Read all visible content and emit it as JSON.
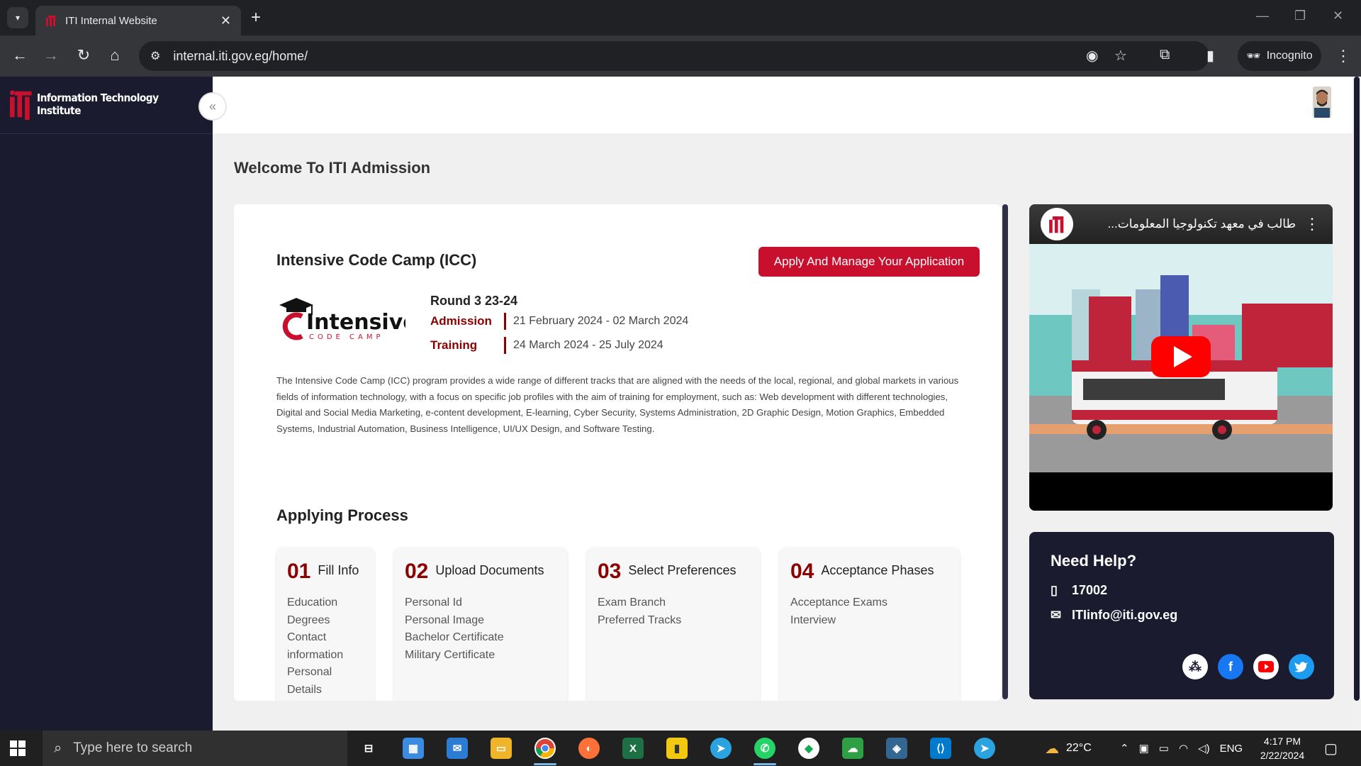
{
  "browser": {
    "tab_title": "ITI Internal Website",
    "url": "internal.iti.gov.eg/home/",
    "incognito_label": "Incognito"
  },
  "sidebar": {
    "brand_name": "Information Technology Institute"
  },
  "main": {
    "welcome": "Welcome To ITI Admission",
    "program_title": "Intensive Code Camp (ICC)",
    "apply_button": "Apply And Manage Your Application",
    "round": "Round 3 23-24",
    "admission_label": "Admission",
    "admission_dates": "21 February 2024 - 02 March 2024",
    "training_label": "Training",
    "training_dates": "24 March 2024 - 25 July 2024",
    "logo": {
      "word": "Intensive",
      "sub": "CODE CAMP"
    },
    "description": "The Intensive Code Camp (ICC) program provides a wide range of different tracks that are aligned with the needs of the local, regional, and global markets in various fields of information technology, with a focus on specific job profiles with the aim of training for employment, such as: Web development with different technologies, Digital and Social Media Marketing, e-content development, E-learning, Cyber Security, Systems Administration, 2D Graphic Design, Motion Graphics, Embedded Systems, Industrial Automation, Business Intelligence, UI/UX Design, and Software Testing.",
    "process_title": "Applying Process",
    "steps": [
      {
        "num": "01",
        "title": "Fill Info",
        "items": [
          "Education",
          "Degrees",
          "Contact",
          "information",
          "Personal",
          "Details"
        ]
      },
      {
        "num": "02",
        "title": "Upload Documents",
        "items": [
          "Personal Id",
          "Personal Image",
          "Bachelor Certificate",
          "Military Certificate"
        ]
      },
      {
        "num": "03",
        "title": "Select Preferences",
        "items": [
          "Exam Branch",
          "Preferred Tracks"
        ]
      },
      {
        "num": "04",
        "title": "Acceptance Phases",
        "items": [
          "Acceptance Exams",
          "Interview"
        ]
      }
    ]
  },
  "video": {
    "title": "...طالب في معهد تكنولوجيا المعلومات"
  },
  "help": {
    "title": "Need Help?",
    "phone": "17002",
    "email": "ITIinfo@iti.gov.eg",
    "socials": [
      "community-icon",
      "facebook-icon",
      "youtube-icon",
      "twitter-icon"
    ]
  },
  "taskbar": {
    "search_placeholder": "Type here to search",
    "temperature": "22°C",
    "language": "ENG",
    "time": "4:17 PM",
    "date": "2/22/2024"
  },
  "colors": {
    "brand_red": "#c8102e",
    "dark_red": "#8b0000",
    "sidebar_navy": "#1a1b2e"
  }
}
